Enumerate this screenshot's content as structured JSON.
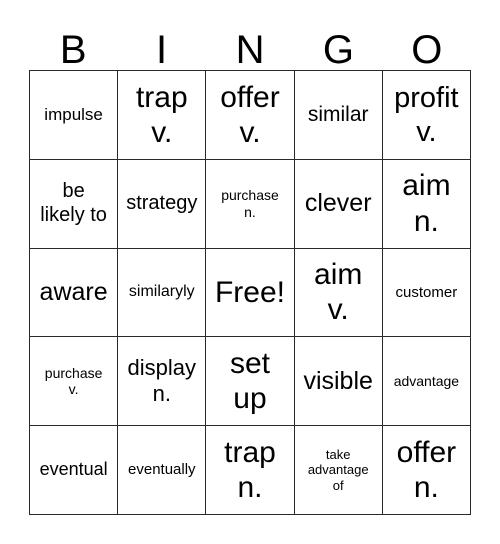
{
  "card": {
    "header_letters": [
      "B",
      "I",
      "N",
      "G",
      "O"
    ],
    "columns": 5,
    "rows": 5,
    "border_color": "#2b2b2b",
    "background_color": "#ffffff",
    "text_color": "#000000",
    "free_space": {
      "row": 2,
      "col": 2,
      "label": "Free!"
    },
    "cells": [
      {
        "text": "impulse",
        "font_size": "17px"
      },
      {
        "text": "trap\nv.",
        "font_size": "30px"
      },
      {
        "text": "offer\nv.",
        "font_size": "30px"
      },
      {
        "text": "similar",
        "font_size": "21px"
      },
      {
        "text": "profit\nv.",
        "font_size": "29px"
      },
      {
        "text": "be\nlikely to",
        "font_size": "20px"
      },
      {
        "text": "strategy",
        "font_size": "20px"
      },
      {
        "text": "purchase\nn.",
        "font_size": "14px"
      },
      {
        "text": "clever",
        "font_size": "25px"
      },
      {
        "text": "aim\nn.",
        "font_size": "30px"
      },
      {
        "text": "aware",
        "font_size": "25px"
      },
      {
        "text": "similaryly",
        "font_size": "16px"
      },
      {
        "text": "Free!",
        "font_size": "30px"
      },
      {
        "text": "aim\nv.",
        "font_size": "30px"
      },
      {
        "text": "customer",
        "font_size": "15px"
      },
      {
        "text": "purchase\nv.",
        "font_size": "14px"
      },
      {
        "text": "display\nn.",
        "font_size": "22px"
      },
      {
        "text": "set\nup",
        "font_size": "30px"
      },
      {
        "text": "visible",
        "font_size": "25px"
      },
      {
        "text": "advantage",
        "font_size": "14px"
      },
      {
        "text": "eventual",
        "font_size": "18px"
      },
      {
        "text": "eventually",
        "font_size": "15px"
      },
      {
        "text": "trap\nn.",
        "font_size": "30px"
      },
      {
        "text": "take\nadvantage\nof",
        "font_size": "13px"
      },
      {
        "text": "offer\nn.",
        "font_size": "30px"
      }
    ]
  }
}
